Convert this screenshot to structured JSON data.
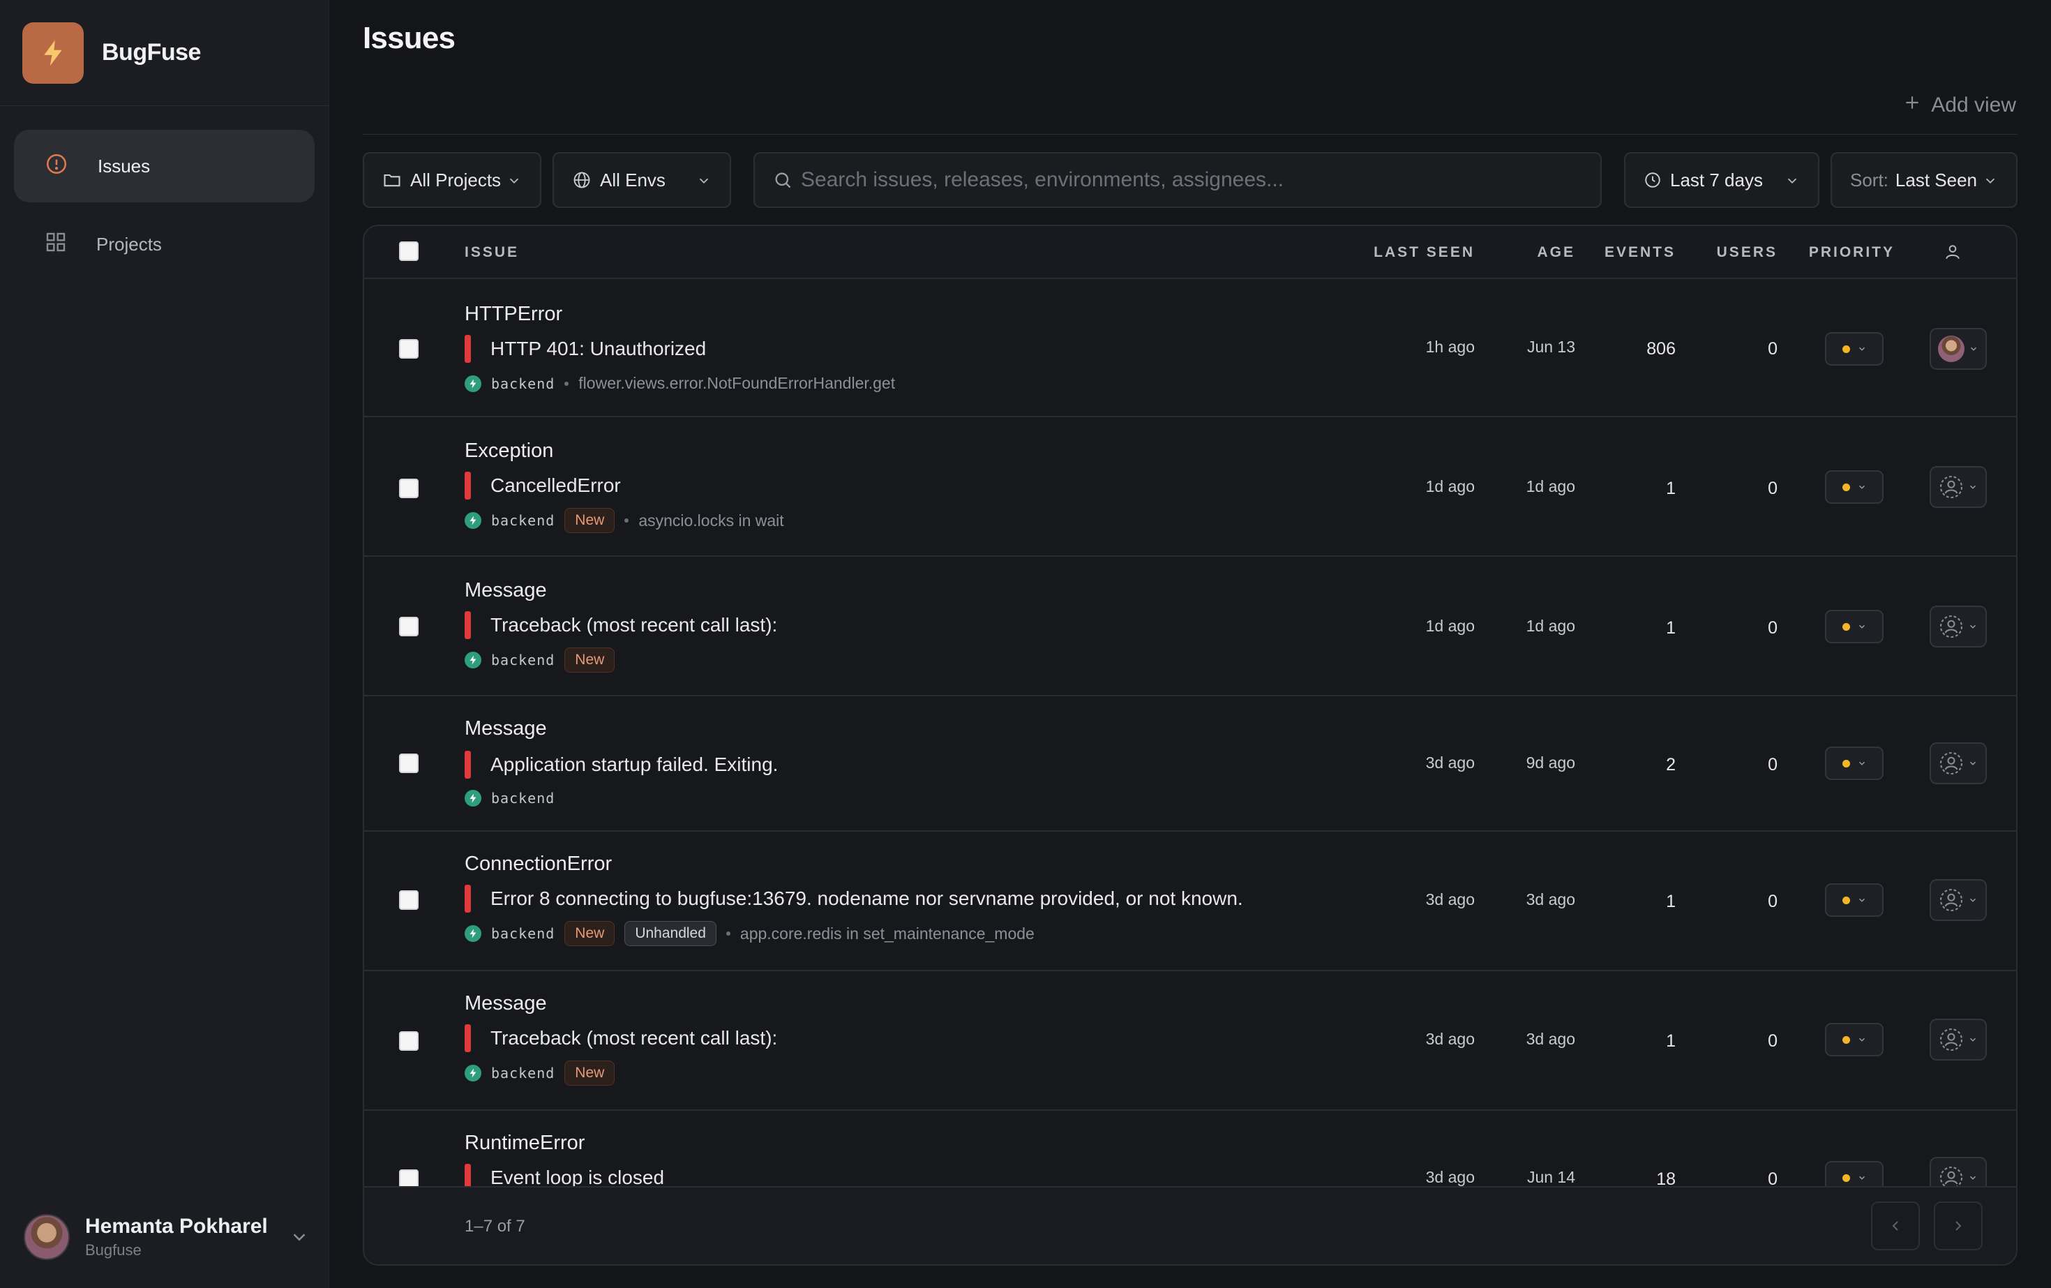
{
  "app": {
    "name": "BugFuse"
  },
  "sidebar": {
    "items": [
      {
        "label": "Issues",
        "icon": "alert-circle-icon",
        "active": true
      },
      {
        "label": "Projects",
        "icon": "grid-icon",
        "active": false
      }
    ],
    "user": {
      "name": "Hemanta Pokharel",
      "org": "Bugfuse"
    }
  },
  "header": {
    "title": "Issues",
    "add_view": "Add view"
  },
  "filters": {
    "projects": "All Projects",
    "envs": "All Envs",
    "search_placeholder": "Search issues, releases, environments, assignees...",
    "date": "Last 7 days",
    "sort_label": "Sort:",
    "sort_value": "Last Seen"
  },
  "table": {
    "columns": {
      "issue": "ISSUE",
      "last_seen": "LAST SEEN",
      "age": "AGE",
      "events": "EVENTS",
      "users": "USERS",
      "priority": "PRIORITY"
    },
    "rows": [
      {
        "type": "HTTPError",
        "message": "HTTP 401: Unauthorized",
        "project": "backend",
        "culprit": "flower.views.error.NotFoundErrorHandler.get",
        "last_seen": "1h ago",
        "age": "Jun 13",
        "events": "806",
        "users": "0"
      },
      {
        "type": "Exception",
        "message": "CancelledError",
        "project": "backend",
        "badge_new": "New",
        "culprit": "asyncio.locks in wait",
        "last_seen": "1d ago",
        "age": "1d ago",
        "events": "1",
        "users": "0"
      },
      {
        "type": "Message",
        "message": "Traceback (most recent call last):",
        "project": "backend",
        "badge_new": "New",
        "last_seen": "1d ago",
        "age": "1d ago",
        "events": "1",
        "users": "0"
      },
      {
        "type": "Message",
        "message": "Application startup failed. Exiting.",
        "project": "backend",
        "last_seen": "3d ago",
        "age": "9d ago",
        "events": "2",
        "users": "0"
      },
      {
        "type": "ConnectionError",
        "message": "Error 8 connecting to bugfuse:13679. nodename nor servname provided, or not known.",
        "project": "backend",
        "badge_new": "New",
        "badge_unhandled": "Unhandled",
        "culprit": "app.core.redis in set_maintenance_mode",
        "last_seen": "3d ago",
        "age": "3d ago",
        "events": "1",
        "users": "0"
      },
      {
        "type": "Message",
        "message": "Traceback (most recent call last):",
        "project": "backend",
        "badge_new": "New",
        "last_seen": "3d ago",
        "age": "3d ago",
        "events": "1",
        "users": "0"
      },
      {
        "type": "RuntimeError",
        "message": "Event loop is closed",
        "last_seen": "3d ago",
        "age": "Jun 14",
        "events": "18",
        "users": "0"
      }
    ]
  },
  "pagination": {
    "text": "1–7 of 7"
  },
  "colors": {
    "accent": "#b96a45",
    "level_error": "#e03a3a",
    "priority_medium": "#f4b526",
    "platform": "#2f9e7d"
  }
}
